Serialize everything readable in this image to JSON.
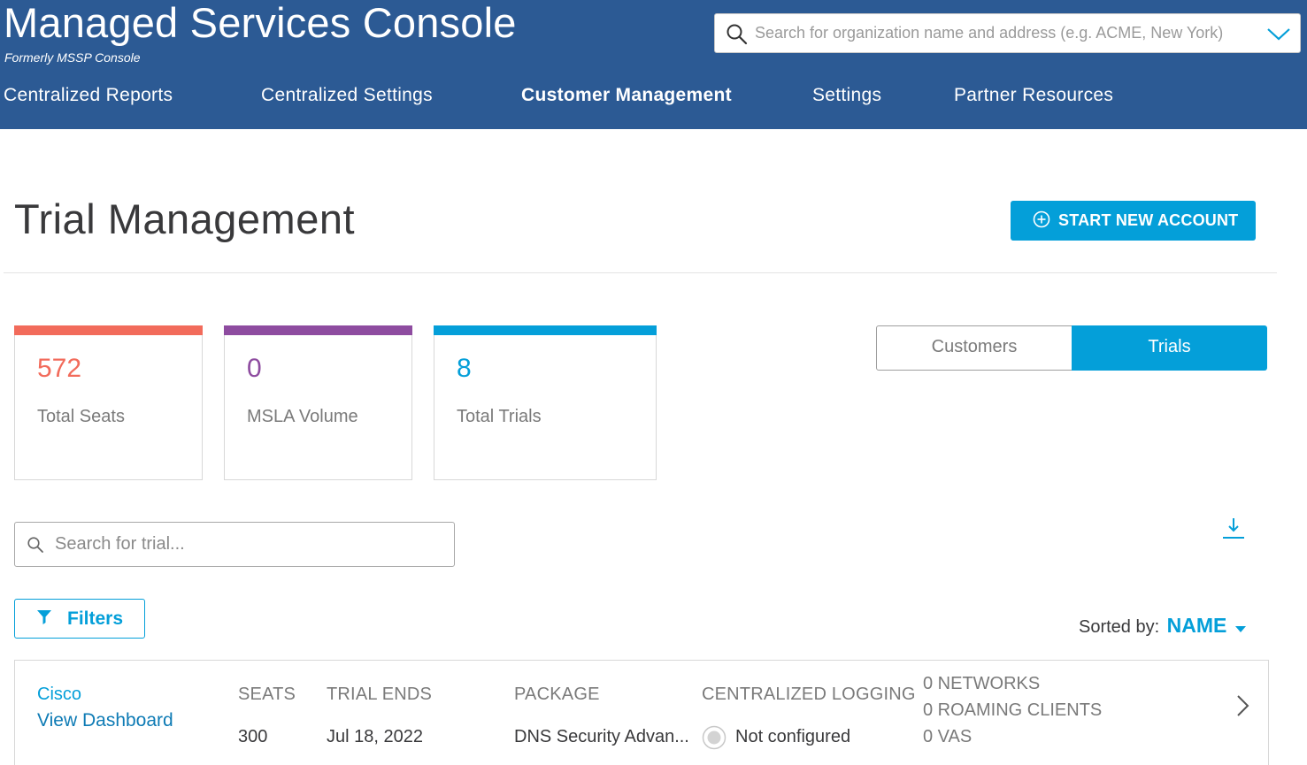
{
  "app": {
    "title": "Managed Services Console",
    "subtitle": "Formerly MSSP Console"
  },
  "global_search": {
    "placeholder": "Search for organization name and address (e.g. ACME, New York)"
  },
  "nav": {
    "items": [
      {
        "label": "Centralized Reports"
      },
      {
        "label": "Centralized Settings"
      },
      {
        "label": "Customer Management"
      },
      {
        "label": "Settings"
      },
      {
        "label": "Partner Resources"
      }
    ],
    "active": "Customer Management"
  },
  "page": {
    "title": "Trial Management",
    "start_button": "START NEW ACCOUNT"
  },
  "stats": [
    {
      "value": "572",
      "label": "Total Seats",
      "color": "#f26b5b"
    },
    {
      "value": "0",
      "label": "MSLA Volume",
      "color": "#8e4ca0"
    },
    {
      "value": "8",
      "label": "Total Trials",
      "color": "#049fd9"
    }
  ],
  "toggle": {
    "options": [
      "Customers",
      "Trials"
    ],
    "selected": "Trials"
  },
  "trial_search": {
    "placeholder": "Search for trial..."
  },
  "filters": {
    "label": "Filters"
  },
  "sort": {
    "label": "Sorted by:",
    "value": "NAME"
  },
  "columns": {
    "seats": "SEATS",
    "trial_ends": "TRIAL ENDS",
    "package": "PACKAGE",
    "logging": "CENTRALIZED LOGGING"
  },
  "trials": [
    {
      "name": "Cisco",
      "dashboard_link": "View Dashboard",
      "seats": "300",
      "trial_ends": "Jul 18, 2022",
      "package": "DNS Security Advan...",
      "logging": "Not configured",
      "networks": "0 NETWORKS",
      "roaming_clients": "0 ROAMING CLIENTS",
      "vas": "0 VAS"
    }
  ],
  "colors": {
    "header_bg": "#2c5a94",
    "accent": "#049fd9"
  }
}
